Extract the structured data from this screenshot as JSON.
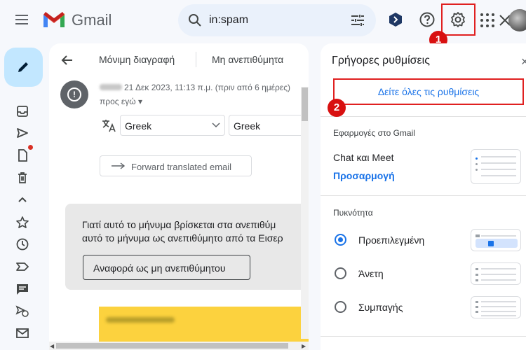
{
  "header": {
    "brand": "Gmail",
    "search_value": "in:spam",
    "colors": {
      "search_bg": "#eaf1fb",
      "highlight": "#e02020",
      "accent": "#1a73e8"
    }
  },
  "badges": [
    "1",
    "2"
  ],
  "toolbar": {
    "delete_forever": "Μόνιμη διαγραφή",
    "not_spam": "Μη ανεπιθύμητα"
  },
  "message": {
    "date": "21 Δεκ 2023, 11:13 π.μ. (πριν από 6 ημέρες)",
    "to_me": "προς εγώ ▾",
    "lang_from": "Greek",
    "lang_to": "Greek",
    "forward_translated": "Forward translated email"
  },
  "spam_notice": {
    "line1": "Γιατί αυτό το μήνυμα βρίσκεται στα ανεπιθύμ",
    "line2": "αυτό το μήνυμα ως ανεπιθύμητο από τα Εισερ",
    "report_button": "Αναφορά ως μη ανεπιθύμητου"
  },
  "quick_settings": {
    "title": "Γρήγορες ρυθμίσεις",
    "close": "×",
    "see_all": "Δείτε όλες τις ρυθμίσεις",
    "apps_heading": "Εφαρμογές στο Gmail",
    "chat_meet": "Chat και Meet",
    "customize": "Προσαρμογή",
    "density_heading": "Πυκνότητα",
    "density_options": [
      {
        "label": "Προεπιλεγμένη",
        "selected": true
      },
      {
        "label": "Άνετη",
        "selected": false
      },
      {
        "label": "Συμπαγής",
        "selected": false
      }
    ]
  },
  "icons": [
    "menu-icon",
    "gmail-logo",
    "search-icon",
    "close-icon",
    "tune-icon",
    "extension-icon",
    "help-icon",
    "gear-icon",
    "apps-icon",
    "avatar",
    "compose-pencil-icon",
    "inbox-icon",
    "send-icon",
    "draft-icon",
    "trash-icon",
    "chevron-up-icon",
    "star-icon",
    "clock-icon",
    "label-icon",
    "chat-icon",
    "scheduled-icon",
    "mail-icon",
    "back-arrow-icon",
    "warning-icon",
    "translate-icon",
    "arrow-right-icon"
  ]
}
